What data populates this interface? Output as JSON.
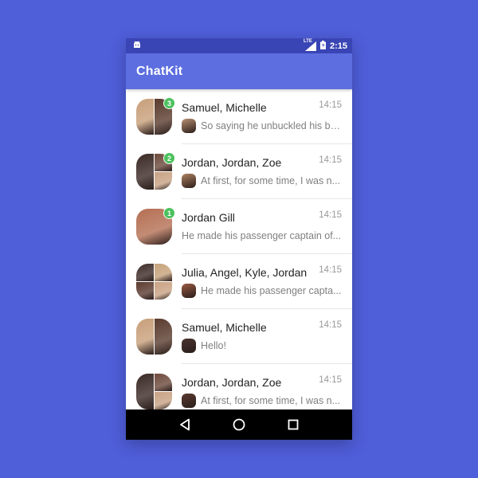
{
  "status_bar": {
    "time": "2:15",
    "network": "LTE"
  },
  "app_bar": {
    "title": "ChatKit"
  },
  "colors": {
    "badge": "#4bc15d",
    "app_bar": "#5c6ee0",
    "status_bar": "#3a45b5",
    "background": "#4f5ed9"
  },
  "dialogs": [
    {
      "name": "Samuel, Michelle",
      "time": "14:15",
      "badge": "3",
      "preview": "So saying he unbuckled his ba...",
      "avatar_tiles": [
        "#c89f7a",
        "#5a3c2e"
      ],
      "sender_tile": "#b99073"
    },
    {
      "name": "Jordan, Jordan, Zoe",
      "time": "14:15",
      "badge": "2",
      "preview": "At first, for some time, I was n...",
      "avatar_tiles": [
        "#3b2a26",
        "#6d4a3c",
        "#c7a284"
      ],
      "sender_tile": "#b08363"
    },
    {
      "name": "Jordan Gill",
      "time": "14:15",
      "badge": "1",
      "preview": "He made his passenger captain of...",
      "avatar_tiles": [
        "#b46f53"
      ],
      "sender_tile": ""
    },
    {
      "name": "Julia, Angel, Kyle, Jordan",
      "time": "14:15",
      "badge": "",
      "preview": "He made his passenger capta...",
      "avatar_tiles": [
        "#3d2b27",
        "#c6a27b",
        "#5b3b30",
        "#c9a284"
      ],
      "sender_tile": "#9a5b44"
    },
    {
      "name": "Samuel, Michelle",
      "time": "14:15",
      "badge": "",
      "preview": "Hello!",
      "avatar_tiles": [
        "#c89f7a",
        "#5a3c2e"
      ],
      "sender_tile": "#4a3530"
    },
    {
      "name": "Jordan, Jordan, Zoe",
      "time": "14:15",
      "badge": "",
      "preview": "At first, for some time, I was n...",
      "avatar_tiles": [
        "#3b2a26",
        "#6d4a3c",
        "#c7a284"
      ],
      "sender_tile": "#5a3a30"
    }
  ],
  "nav": {
    "back": "back-icon",
    "home": "home-icon",
    "recents": "recents-icon"
  }
}
